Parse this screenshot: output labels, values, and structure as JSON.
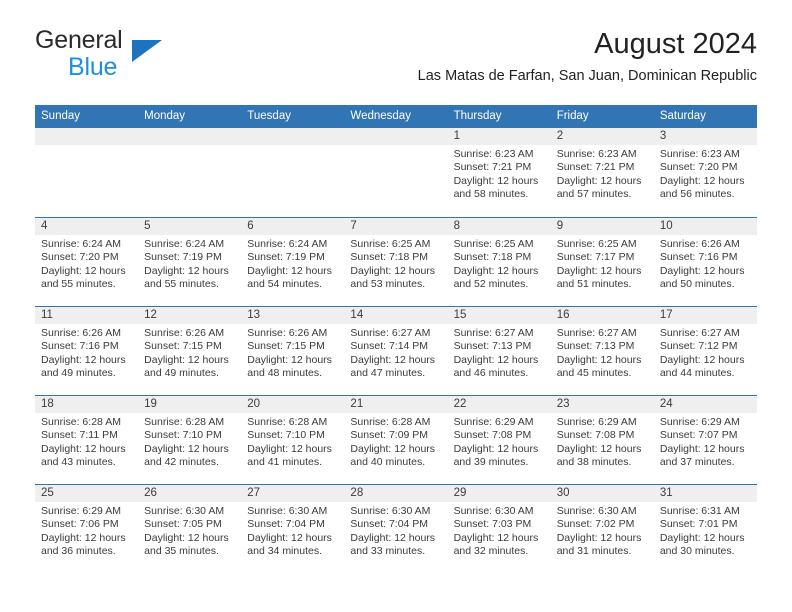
{
  "brand": {
    "name_top": "General",
    "name_bottom": "Blue",
    "triangle_icon": "triangle-right-icon",
    "color_dark": "#2b2b2b",
    "color_blue": "#1d8fe0",
    "color_triangle": "#1d73bd"
  },
  "header": {
    "title": "August 2024",
    "subtitle": "Las Matas de Farfan, San Juan, Dominican Republic"
  },
  "theme": {
    "header_blue": "#3175b4",
    "day_band_gray": "#efefef",
    "text": "#3b3b3b"
  },
  "weekdays": [
    "Sunday",
    "Monday",
    "Tuesday",
    "Wednesday",
    "Thursday",
    "Friday",
    "Saturday"
  ],
  "weeks": [
    [
      {
        "day": "",
        "sunrise": "",
        "sunset": "",
        "daylight_line1": "",
        "daylight_line2": "",
        "empty": true
      },
      {
        "day": "",
        "sunrise": "",
        "sunset": "",
        "daylight_line1": "",
        "daylight_line2": "",
        "empty": true
      },
      {
        "day": "",
        "sunrise": "",
        "sunset": "",
        "daylight_line1": "",
        "daylight_line2": "",
        "empty": true
      },
      {
        "day": "",
        "sunrise": "",
        "sunset": "",
        "daylight_line1": "",
        "daylight_line2": "",
        "empty": true
      },
      {
        "day": "1",
        "sunrise": "Sunrise: 6:23 AM",
        "sunset": "Sunset: 7:21 PM",
        "daylight_line1": "Daylight: 12 hours",
        "daylight_line2": "and 58 minutes."
      },
      {
        "day": "2",
        "sunrise": "Sunrise: 6:23 AM",
        "sunset": "Sunset: 7:21 PM",
        "daylight_line1": "Daylight: 12 hours",
        "daylight_line2": "and 57 minutes."
      },
      {
        "day": "3",
        "sunrise": "Sunrise: 6:23 AM",
        "sunset": "Sunset: 7:20 PM",
        "daylight_line1": "Daylight: 12 hours",
        "daylight_line2": "and 56 minutes."
      }
    ],
    [
      {
        "day": "4",
        "sunrise": "Sunrise: 6:24 AM",
        "sunset": "Sunset: 7:20 PM",
        "daylight_line1": "Daylight: 12 hours",
        "daylight_line2": "and 55 minutes."
      },
      {
        "day": "5",
        "sunrise": "Sunrise: 6:24 AM",
        "sunset": "Sunset: 7:19 PM",
        "daylight_line1": "Daylight: 12 hours",
        "daylight_line2": "and 55 minutes."
      },
      {
        "day": "6",
        "sunrise": "Sunrise: 6:24 AM",
        "sunset": "Sunset: 7:19 PM",
        "daylight_line1": "Daylight: 12 hours",
        "daylight_line2": "and 54 minutes."
      },
      {
        "day": "7",
        "sunrise": "Sunrise: 6:25 AM",
        "sunset": "Sunset: 7:18 PM",
        "daylight_line1": "Daylight: 12 hours",
        "daylight_line2": "and 53 minutes."
      },
      {
        "day": "8",
        "sunrise": "Sunrise: 6:25 AM",
        "sunset": "Sunset: 7:18 PM",
        "daylight_line1": "Daylight: 12 hours",
        "daylight_line2": "and 52 minutes."
      },
      {
        "day": "9",
        "sunrise": "Sunrise: 6:25 AM",
        "sunset": "Sunset: 7:17 PM",
        "daylight_line1": "Daylight: 12 hours",
        "daylight_line2": "and 51 minutes."
      },
      {
        "day": "10",
        "sunrise": "Sunrise: 6:26 AM",
        "sunset": "Sunset: 7:16 PM",
        "daylight_line1": "Daylight: 12 hours",
        "daylight_line2": "and 50 minutes."
      }
    ],
    [
      {
        "day": "11",
        "sunrise": "Sunrise: 6:26 AM",
        "sunset": "Sunset: 7:16 PM",
        "daylight_line1": "Daylight: 12 hours",
        "daylight_line2": "and 49 minutes."
      },
      {
        "day": "12",
        "sunrise": "Sunrise: 6:26 AM",
        "sunset": "Sunset: 7:15 PM",
        "daylight_line1": "Daylight: 12 hours",
        "daylight_line2": "and 49 minutes."
      },
      {
        "day": "13",
        "sunrise": "Sunrise: 6:26 AM",
        "sunset": "Sunset: 7:15 PM",
        "daylight_line1": "Daylight: 12 hours",
        "daylight_line2": "and 48 minutes."
      },
      {
        "day": "14",
        "sunrise": "Sunrise: 6:27 AM",
        "sunset": "Sunset: 7:14 PM",
        "daylight_line1": "Daylight: 12 hours",
        "daylight_line2": "and 47 minutes."
      },
      {
        "day": "15",
        "sunrise": "Sunrise: 6:27 AM",
        "sunset": "Sunset: 7:13 PM",
        "daylight_line1": "Daylight: 12 hours",
        "daylight_line2": "and 46 minutes."
      },
      {
        "day": "16",
        "sunrise": "Sunrise: 6:27 AM",
        "sunset": "Sunset: 7:13 PM",
        "daylight_line1": "Daylight: 12 hours",
        "daylight_line2": "and 45 minutes."
      },
      {
        "day": "17",
        "sunrise": "Sunrise: 6:27 AM",
        "sunset": "Sunset: 7:12 PM",
        "daylight_line1": "Daylight: 12 hours",
        "daylight_line2": "and 44 minutes."
      }
    ],
    [
      {
        "day": "18",
        "sunrise": "Sunrise: 6:28 AM",
        "sunset": "Sunset: 7:11 PM",
        "daylight_line1": "Daylight: 12 hours",
        "daylight_line2": "and 43 minutes."
      },
      {
        "day": "19",
        "sunrise": "Sunrise: 6:28 AM",
        "sunset": "Sunset: 7:10 PM",
        "daylight_line1": "Daylight: 12 hours",
        "daylight_line2": "and 42 minutes."
      },
      {
        "day": "20",
        "sunrise": "Sunrise: 6:28 AM",
        "sunset": "Sunset: 7:10 PM",
        "daylight_line1": "Daylight: 12 hours",
        "daylight_line2": "and 41 minutes."
      },
      {
        "day": "21",
        "sunrise": "Sunrise: 6:28 AM",
        "sunset": "Sunset: 7:09 PM",
        "daylight_line1": "Daylight: 12 hours",
        "daylight_line2": "and 40 minutes."
      },
      {
        "day": "22",
        "sunrise": "Sunrise: 6:29 AM",
        "sunset": "Sunset: 7:08 PM",
        "daylight_line1": "Daylight: 12 hours",
        "daylight_line2": "and 39 minutes."
      },
      {
        "day": "23",
        "sunrise": "Sunrise: 6:29 AM",
        "sunset": "Sunset: 7:08 PM",
        "daylight_line1": "Daylight: 12 hours",
        "daylight_line2": "and 38 minutes."
      },
      {
        "day": "24",
        "sunrise": "Sunrise: 6:29 AM",
        "sunset": "Sunset: 7:07 PM",
        "daylight_line1": "Daylight: 12 hours",
        "daylight_line2": "and 37 minutes."
      }
    ],
    [
      {
        "day": "25",
        "sunrise": "Sunrise: 6:29 AM",
        "sunset": "Sunset: 7:06 PM",
        "daylight_line1": "Daylight: 12 hours",
        "daylight_line2": "and 36 minutes."
      },
      {
        "day": "26",
        "sunrise": "Sunrise: 6:30 AM",
        "sunset": "Sunset: 7:05 PM",
        "daylight_line1": "Daylight: 12 hours",
        "daylight_line2": "and 35 minutes."
      },
      {
        "day": "27",
        "sunrise": "Sunrise: 6:30 AM",
        "sunset": "Sunset: 7:04 PM",
        "daylight_line1": "Daylight: 12 hours",
        "daylight_line2": "and 34 minutes."
      },
      {
        "day": "28",
        "sunrise": "Sunrise: 6:30 AM",
        "sunset": "Sunset: 7:04 PM",
        "daylight_line1": "Daylight: 12 hours",
        "daylight_line2": "and 33 minutes."
      },
      {
        "day": "29",
        "sunrise": "Sunrise: 6:30 AM",
        "sunset": "Sunset: 7:03 PM",
        "daylight_line1": "Daylight: 12 hours",
        "daylight_line2": "and 32 minutes."
      },
      {
        "day": "30",
        "sunrise": "Sunrise: 6:30 AM",
        "sunset": "Sunset: 7:02 PM",
        "daylight_line1": "Daylight: 12 hours",
        "daylight_line2": "and 31 minutes."
      },
      {
        "day": "31",
        "sunrise": "Sunrise: 6:31 AM",
        "sunset": "Sunset: 7:01 PM",
        "daylight_line1": "Daylight: 12 hours",
        "daylight_line2": "and 30 minutes."
      }
    ]
  ]
}
